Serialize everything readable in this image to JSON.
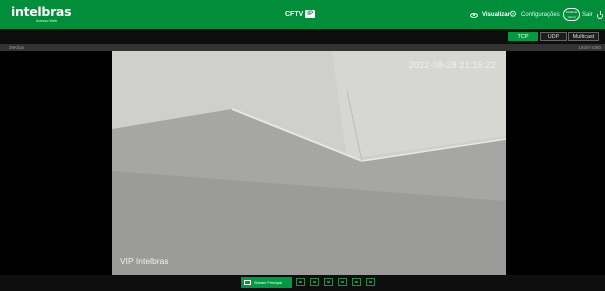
{
  "header": {
    "logo": "intelbras",
    "logo_tagline": "Acesso Web",
    "brand": "CFTV",
    "brand_badge": "IP",
    "nav": {
      "visualizar": "Visualizar",
      "configuracoes": "Configurações",
      "cloud_label": "Intelbras Cloud",
      "sair": "Sair"
    }
  },
  "protocols": {
    "items": [
      "TCP",
      "UDP",
      "Multicast"
    ],
    "active": "TCP"
  },
  "stats": {
    "bitrate": "39Kbps",
    "resolution": "1920×1080"
  },
  "video": {
    "timestamp": "2022-08-28 21:15:22",
    "channel_name": "VIP Intelbras"
  },
  "toolbar": {
    "stream_label": "Stream Principal",
    "tools": [
      "snapshot-icon",
      "record-icon",
      "zoom-icon",
      "audio-icon",
      "ptz-icon",
      "fullscreen-icon"
    ]
  },
  "colors": {
    "brand_green": "#008e3b",
    "active_green": "#009a42"
  }
}
